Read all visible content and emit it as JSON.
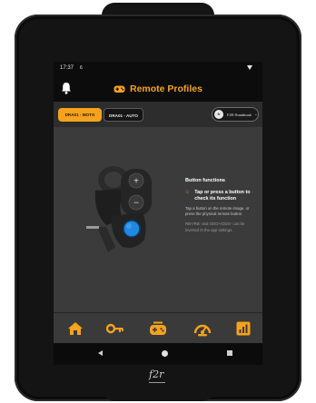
{
  "statusbar": {
    "time": "17:37",
    "notification": "6"
  },
  "header": {
    "title": "Remote Profiles"
  },
  "tabs": [
    {
      "label": "DRA01 - MOTO",
      "active": true
    },
    {
      "label": "DRA01 - AUTO",
      "active": false
    }
  ],
  "device_selector": {
    "label": "F2R Roadbook",
    "logo": "fr"
  },
  "info": {
    "heading": "Button functions",
    "tip": "Tap or press a button to check its function",
    "body": "Tap a button on the remote image, or press the physical remote button.",
    "note": "RB+/RB- and ODO+/ODO- can be inverted in the app settings."
  },
  "remote_buttons": {
    "plus": "+",
    "minus": "−"
  },
  "bottom_nav": [
    {
      "icon": "home-icon"
    },
    {
      "icon": "key-icon"
    },
    {
      "icon": "gamepad-icon"
    },
    {
      "icon": "gauge-icon"
    },
    {
      "icon": "chart-icon"
    }
  ],
  "brand": "f2r",
  "colors": {
    "accent": "#f5a21d",
    "screen_bg": "#3b3b3b",
    "bar_bg": "#0c0c0c",
    "highlight_button": "#1e88e5"
  }
}
